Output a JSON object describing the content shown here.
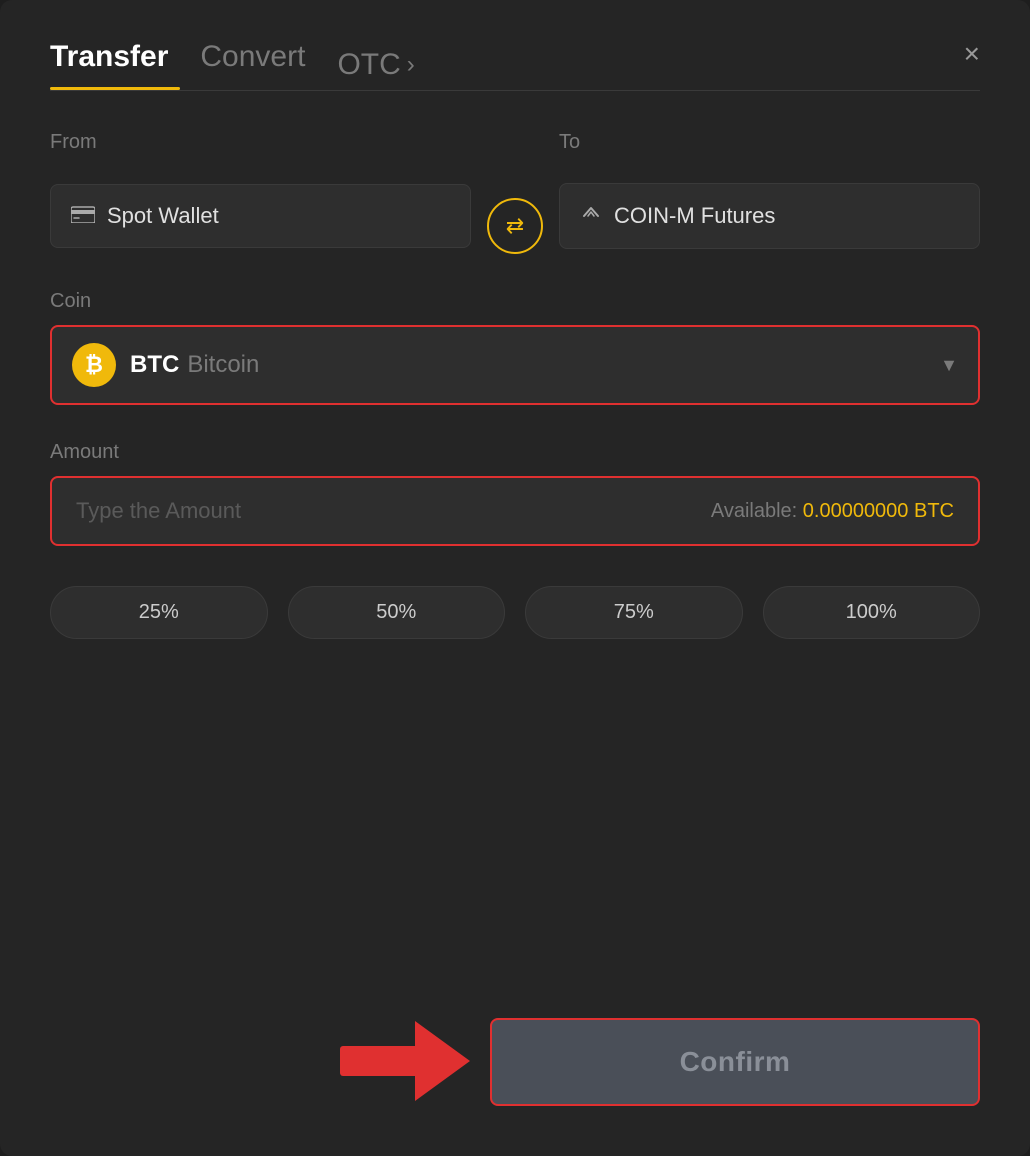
{
  "header": {
    "title": "Transfer",
    "tabs": [
      {
        "label": "Transfer",
        "active": true
      },
      {
        "label": "Convert",
        "active": false
      },
      {
        "label": "OTC",
        "active": false
      }
    ],
    "close_label": "×"
  },
  "from": {
    "label": "From",
    "wallet": "Spot Wallet",
    "wallet_icon": "card"
  },
  "to": {
    "label": "To",
    "wallet": "COIN-M Futures",
    "wallet_icon": "arrow-up"
  },
  "swap_button_label": "⇄",
  "coin": {
    "label": "Coin",
    "ticker": "BTC",
    "name": "Bitcoin",
    "dropdown_arrow": "▼"
  },
  "amount": {
    "label": "Amount",
    "placeholder": "Type the Amount",
    "available_label": "Available:",
    "available_value": "0.00000000 BTC"
  },
  "percentages": [
    "25%",
    "50%",
    "75%",
    "100%"
  ],
  "confirm_button": "Confirm"
}
